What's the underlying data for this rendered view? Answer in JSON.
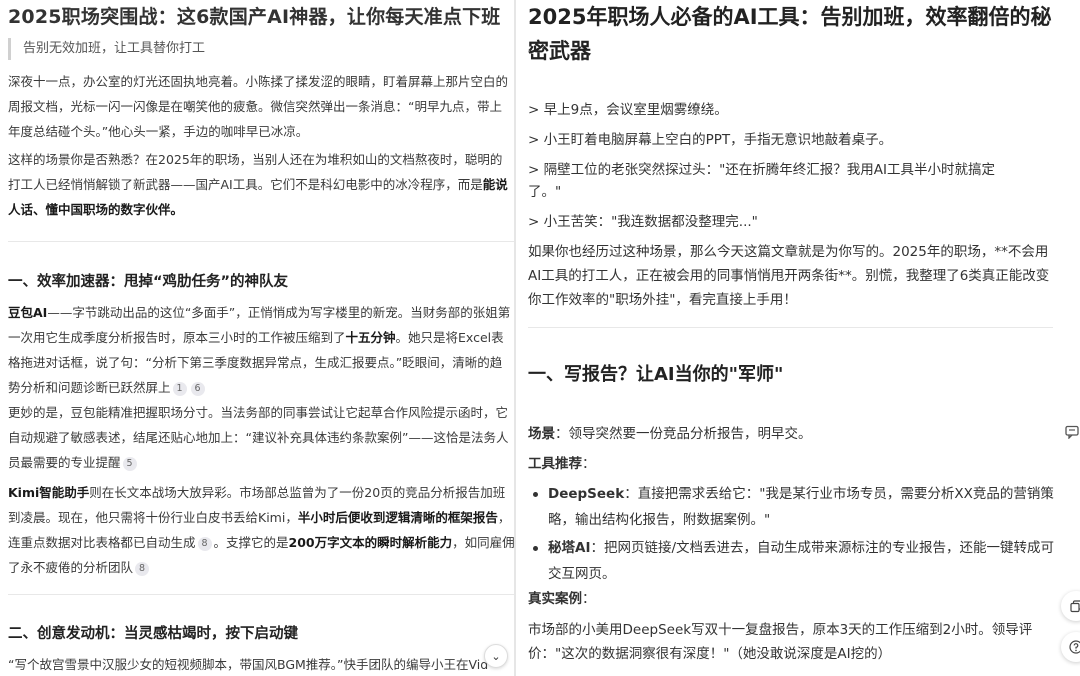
{
  "left": {
    "title": "2025职场突围战：这6款国产AI神器，让你每天准点下班",
    "quote": "告别无效加班，让工具替你打工",
    "p1_lines": [
      "深夜十一点，办公室的灯光还固执地亮着。小陈揉了揉发涩的眼睛，盯着屏幕上那片空白的",
      "周报文档，光标一闪一闪像是在嘲笑他的疲惫。微信突然弹出一条消息：“明早九点，带上",
      "年度总结碰个头。”他心头一紧，手边的咖啡早已冰凉。"
    ],
    "p2_l1": "这样的场景你是否熟悉？在2025年的职场，当别人还在为堆积如山的文档熬夜时，聪明的",
    "p2_l2a": "打工人已经悄悄解锁了新武器——国产AI工具。它们不是科幻电影中的冰冷程序，而是",
    "p2_l2b": "能说",
    "p2_l3": "人话、懂中国职场的数字伙伴。",
    "h1": "一、效率加速器：甩掉“鸡肋任务”的神队友",
    "p3_l1a": "豆包AI",
    "p3_l1b": "——字节跳动出品的这位“多面手”，正悄悄成为写字楼里的新宠。当财务部的张姐第",
    "p3_l2a": "一次用它生成季度分析报告时，原本三小时的工作被压缩到了",
    "p3_l2b": "十五分钟",
    "p3_l2c": "。她只是将Excel表",
    "p3_l3": "格拖进对话框，说了句：“分析下第三季度数据异常点，生成汇报要点。”眨眼间，清晰的趋",
    "p3_l4": "势分析和问题诊断已跃然屏上",
    "p3_cite1": "1",
    "p3_cite2": "6",
    "p4_l1": "更妙的是，豆包能精准把握职场分寸。当法务部的同事尝试让它起草合作风险提示函时，它",
    "p4_l2": "自动规避了敏感表述，结尾还贴心地加上：“建议补充具体违约条款案例”——这恰是法务人",
    "p4_l3": "员最需要的专业提醒",
    "p4_cite": "5",
    "p5_l1a": "Kimi智能助手",
    "p5_l1b": "则在长文本战场大放异彩。市场部总监曾为了一份20页的竞品分析报告加班",
    "p5_l2a": "到凌晨。现在，他只需将十份行业白皮书丢给Kimi，",
    "p5_l2b": "半小时后便收到逻辑清晰的框架报告",
    "p5_l2c": "，",
    "p5_l3a": "连重点数据对比表格都已自动生成",
    "p5_cite1": "8",
    "p5_l3b": "。支撑它的是",
    "p5_l3c": "200万字文本的瞬时解析能力",
    "p5_l3d": "，如同雇佣",
    "p5_l4": "了永不疲倦的分析团队",
    "p5_cite2": "8",
    "h2": "二、创意发动机：当灵感枯竭时，按下启动键",
    "p6_l1": "“写个故宫雪景中汉服少女的短视频脚本，带国风BGM推荐。”快手团队的编导小王在Vid"
  },
  "right": {
    "title": "2025年职场人必备的AI工具：告别加班，效率翻倍的秘密武器",
    "quotes": [
      "> 早上9点，会议室里烟雾缭绕。",
      "> 小王盯着电脑屏幕上空白的PPT，手指无意识地敲着桌子。",
      "> 隔壁工位的老张突然探过头：\"还在折腾年终汇报？我用AI工具半小时就搞定",
      "了。\"",
      "> 小王苦笑：\"我连数据都没整理完...\""
    ],
    "intro": "如果你也经历过这种场景，那么今天这篇文章就是为你写的。2025年的职场，**不会用AI工具的打工人，正在被会用的同事悄悄甩开两条街**。别慌，我整理了6类真正能改变你工作效率的\"职场外挂\"，看完直接上手用！",
    "h1": "一、写报告？让AI当你的\"军师\"",
    "scene_label": "场景",
    "scene_text": "：领导突然要一份竞品分析报告，明早交。",
    "tools_label": "工具推荐",
    "tools_colon": "：",
    "b1_label": "DeepSeek",
    "b1_text": "：直接把需求丢给它：\"我是某行业市场专员，需要分析XX竞品的营销策略，输出结构化报告，附数据案例。\"",
    "b2_label": "秘塔AI",
    "b2_text": "：把网页链接/文档丢进去，自动生成带来源标注的专业报告，还能一键转成可交互网页。",
    "case_label": "真实案例",
    "case_colon": "：",
    "case_text": "市场部的小美用DeepSeek写双十一复盘报告，原本3天的工作压缩到2小时。领导评价：\"这次的数据洞察很有深度！\"（她没敢说深度是AI挖的）"
  }
}
